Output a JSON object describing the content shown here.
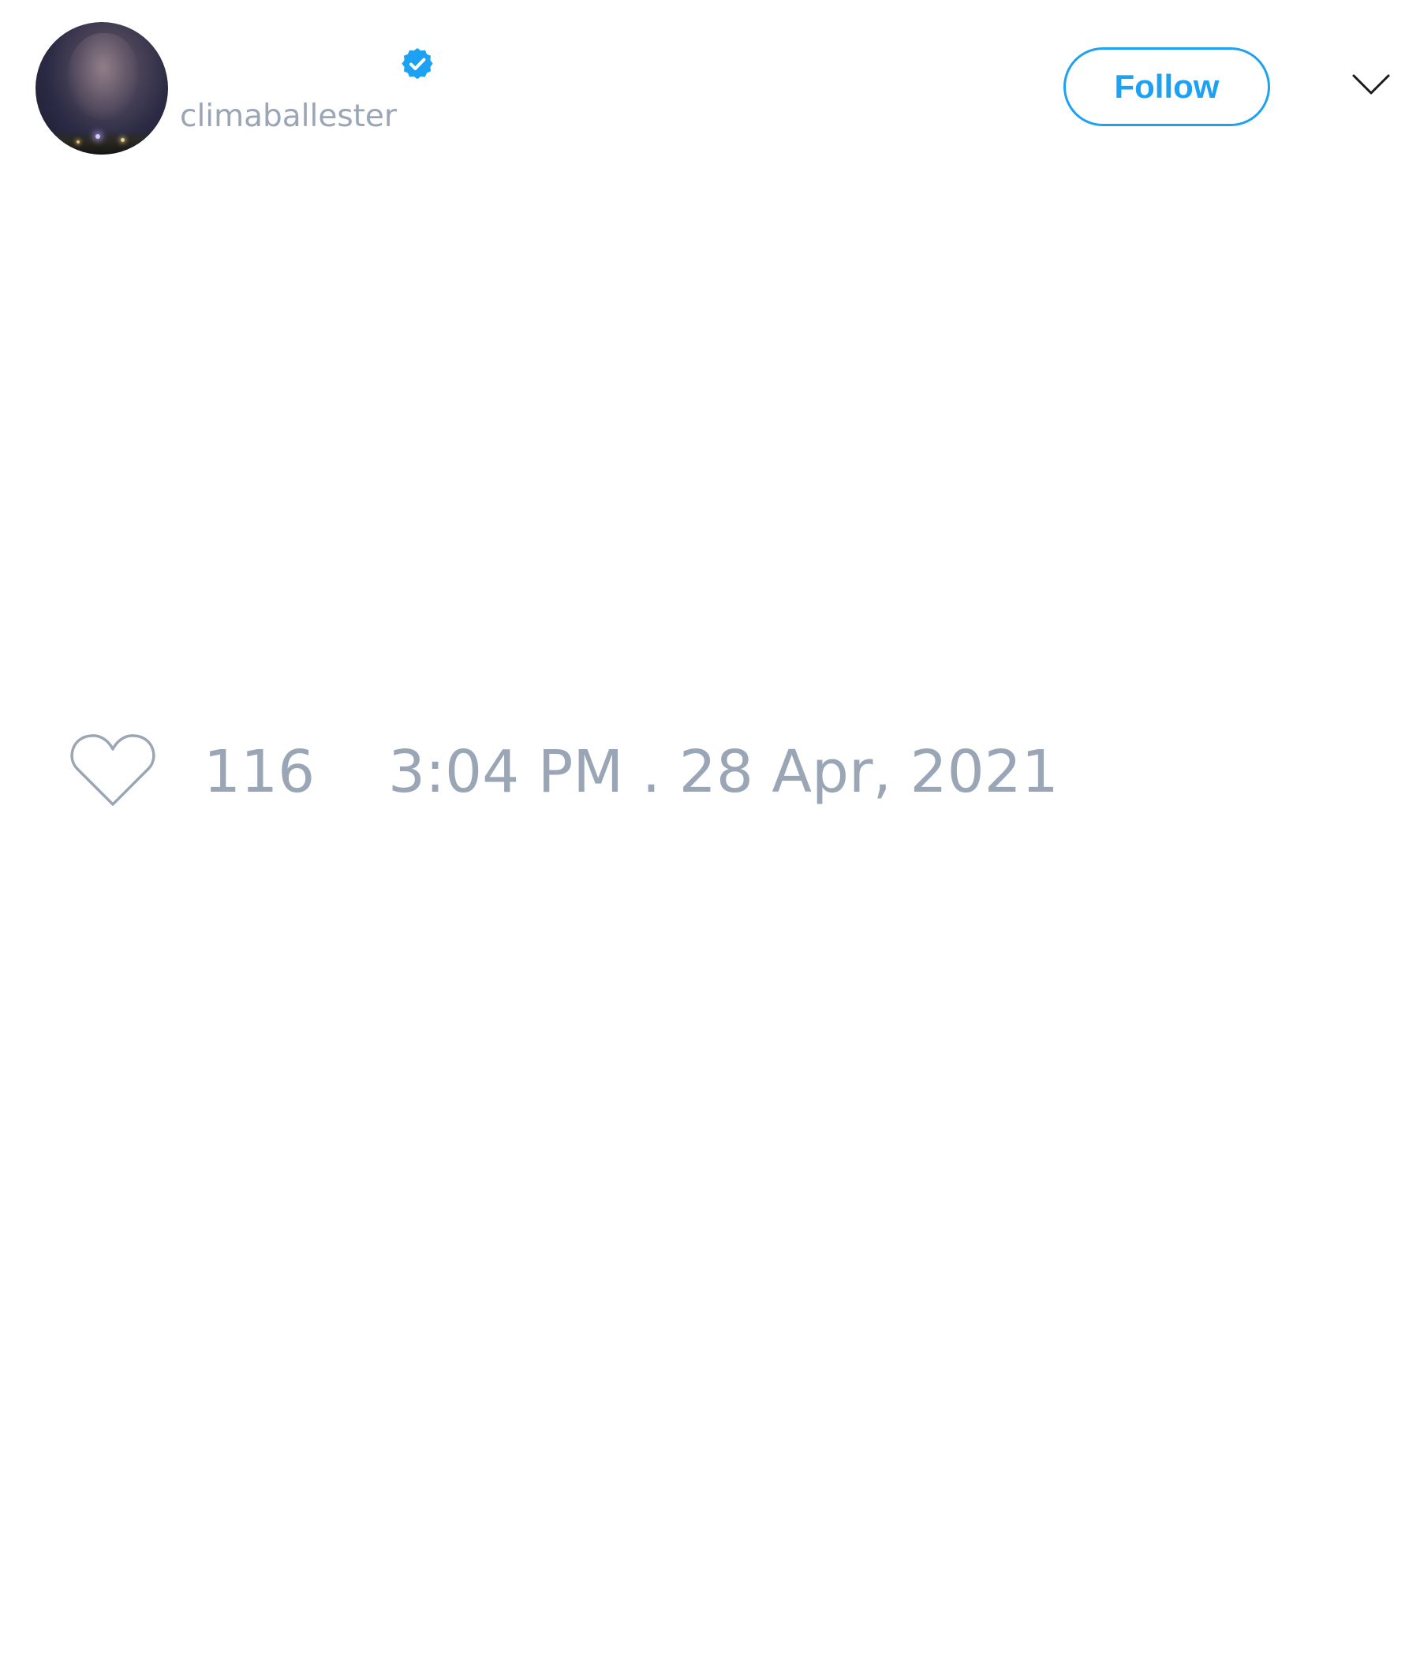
{
  "header": {
    "handle": "climaballester",
    "follow_label": "Follow"
  },
  "footer": {
    "likes_count": "116",
    "timestamp": "3:04 PM . 28 Apr, 2021"
  },
  "icons": {
    "verified": "verified-badge-icon",
    "menu": "chevron-down-icon",
    "like": "heart-icon"
  },
  "colors": {
    "accent": "#1da1f2",
    "muted_text": "#9aa6b6"
  }
}
